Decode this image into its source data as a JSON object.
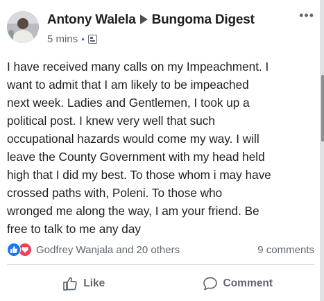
{
  "post": {
    "author": "Antony Walela",
    "group": "Bungoma Digest",
    "time": "5 mins",
    "dot": "•",
    "audience_icon": "group-audience-icon",
    "more_icon": "•••",
    "text": "I have received many calls on my Impeachment. I\nwant to admit that I am likely to be impeached\nnext week. Ladies and Gentlemen, I took up a\npolitical post. I knew very well that such\noccupational hazards would come my way. I will\nleave the County Government with my head held\nhigh that I did my best. To those whom i may have\ncrossed paths with, Poleni.   To those who\nwronged me along the way, I am your friend. Be\nfree to talk to me any day"
  },
  "reactions": {
    "icons": [
      "like-reaction",
      "love-reaction"
    ],
    "summary": "Godfrey Wanjala and 20 others",
    "comments": "9 comments"
  },
  "actions": {
    "like": "Like",
    "comment": "Comment"
  },
  "colors": {
    "like_blue": "#1877f2",
    "love_red": "#f33e58",
    "meta_gray": "#606770",
    "text": "#1c1e21"
  }
}
